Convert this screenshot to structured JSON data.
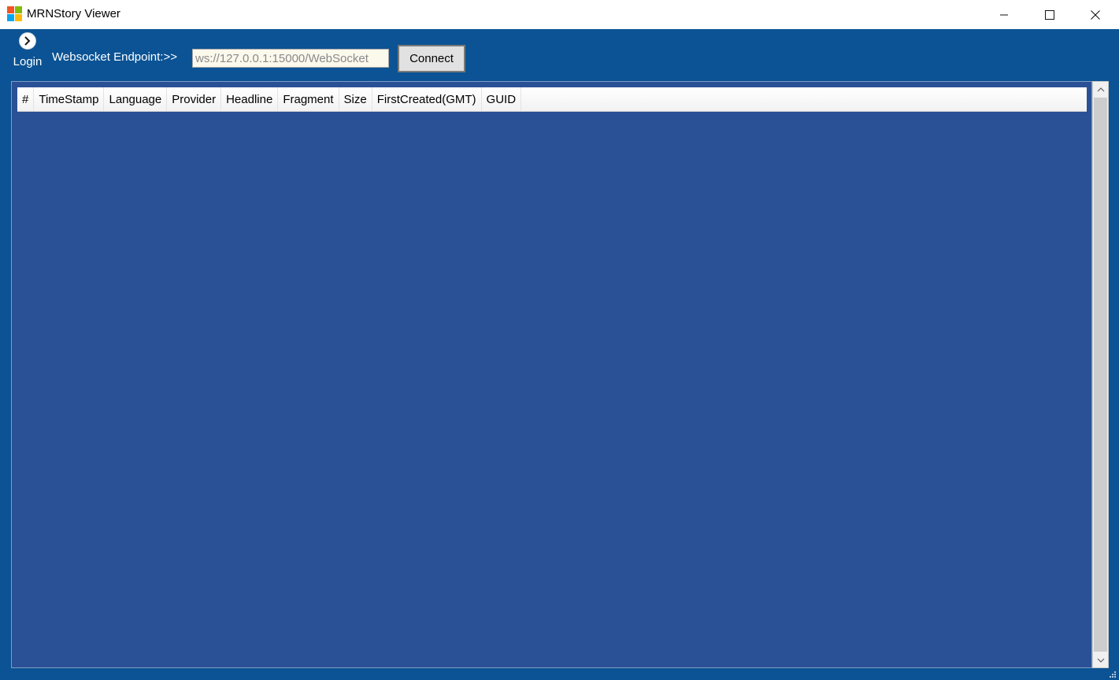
{
  "window": {
    "title": "MRNStory Viewer",
    "controls": [
      "minimize",
      "maximize",
      "close"
    ]
  },
  "toolbar": {
    "login_label": "Login",
    "endpoint_label": "Websocket Endpoint:>>",
    "endpoint_placeholder": "ws://127.0.0.1:15000/WebSocket",
    "connect_label": "Connect"
  },
  "grid": {
    "columns": [
      "#",
      "TimeStamp",
      "Language",
      "Provider",
      "Headline",
      "Fragment",
      "Size",
      "FirstCreated(GMT)",
      "GUID"
    ],
    "rows": []
  },
  "icons": {
    "app": "windows-logo-icon",
    "login": "chevron-right-circle-icon",
    "minimize": "minimize-icon",
    "maximize": "maximize-icon",
    "close": "close-icon",
    "scroll_up": "scroll-up-arrow-icon",
    "scroll_down": "scroll-down-arrow-icon",
    "resize": "resize-grip-icon"
  },
  "colors": {
    "window_bg": "#0b5394",
    "grid_bg": "#2a5196",
    "logo": [
      "#f35325",
      "#81bc06",
      "#05a6f0",
      "#ffba08"
    ]
  }
}
